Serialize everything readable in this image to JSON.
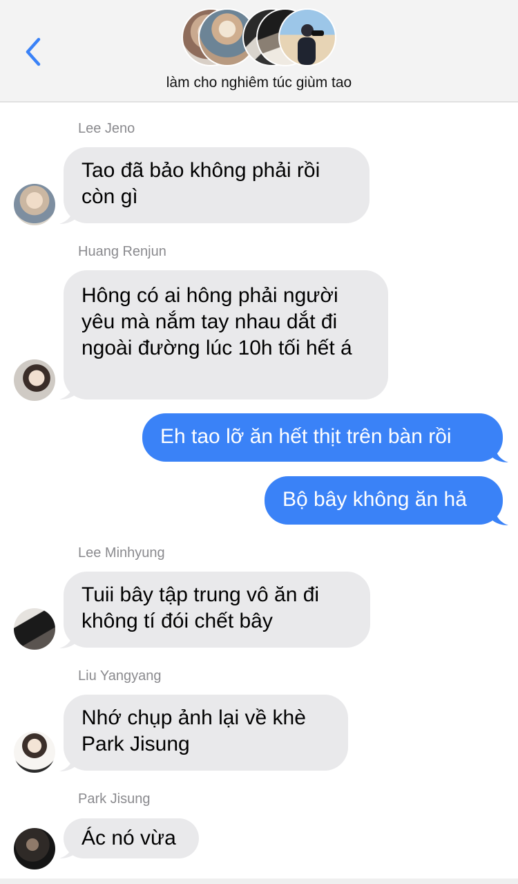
{
  "header": {
    "title": "làm cho nghiêm túc giùm tao",
    "back_icon": "chevron-left-icon",
    "accent": "#3a82f7"
  },
  "messages": [
    {
      "sender": "Lee Jeno",
      "text": "Tao đã bảo không phải rồi còn gì",
      "direction": "incoming"
    },
    {
      "sender": "Huang Renjun",
      "text": "Hông có ai hông phải người yêu mà nắm tay nhau dắt đi ngoài đường lúc 10h tối hết á",
      "direction": "incoming"
    },
    {
      "text": "Eh tao lỡ ăn hết thịt trên bàn rồi",
      "direction": "outgoing"
    },
    {
      "text": "Bộ bây không ăn hả",
      "direction": "outgoing"
    },
    {
      "sender": "Lee Minhyung",
      "text": "Tuii bây tập trung vô ăn đi không tí đói chết bây",
      "direction": "incoming"
    },
    {
      "sender": "Liu Yangyang",
      "text": "Nhớ chụp ảnh lại về khè Park Jisung",
      "direction": "incoming"
    },
    {
      "sender": "Park Jisung",
      "text": "Ác nó vừa",
      "direction": "incoming"
    }
  ],
  "colors": {
    "incoming_bubble": "#e9e9eb",
    "outgoing_bubble": "#3a82f7",
    "sender_name": "#8a8a8e",
    "header_bg": "#f3f3f3"
  }
}
